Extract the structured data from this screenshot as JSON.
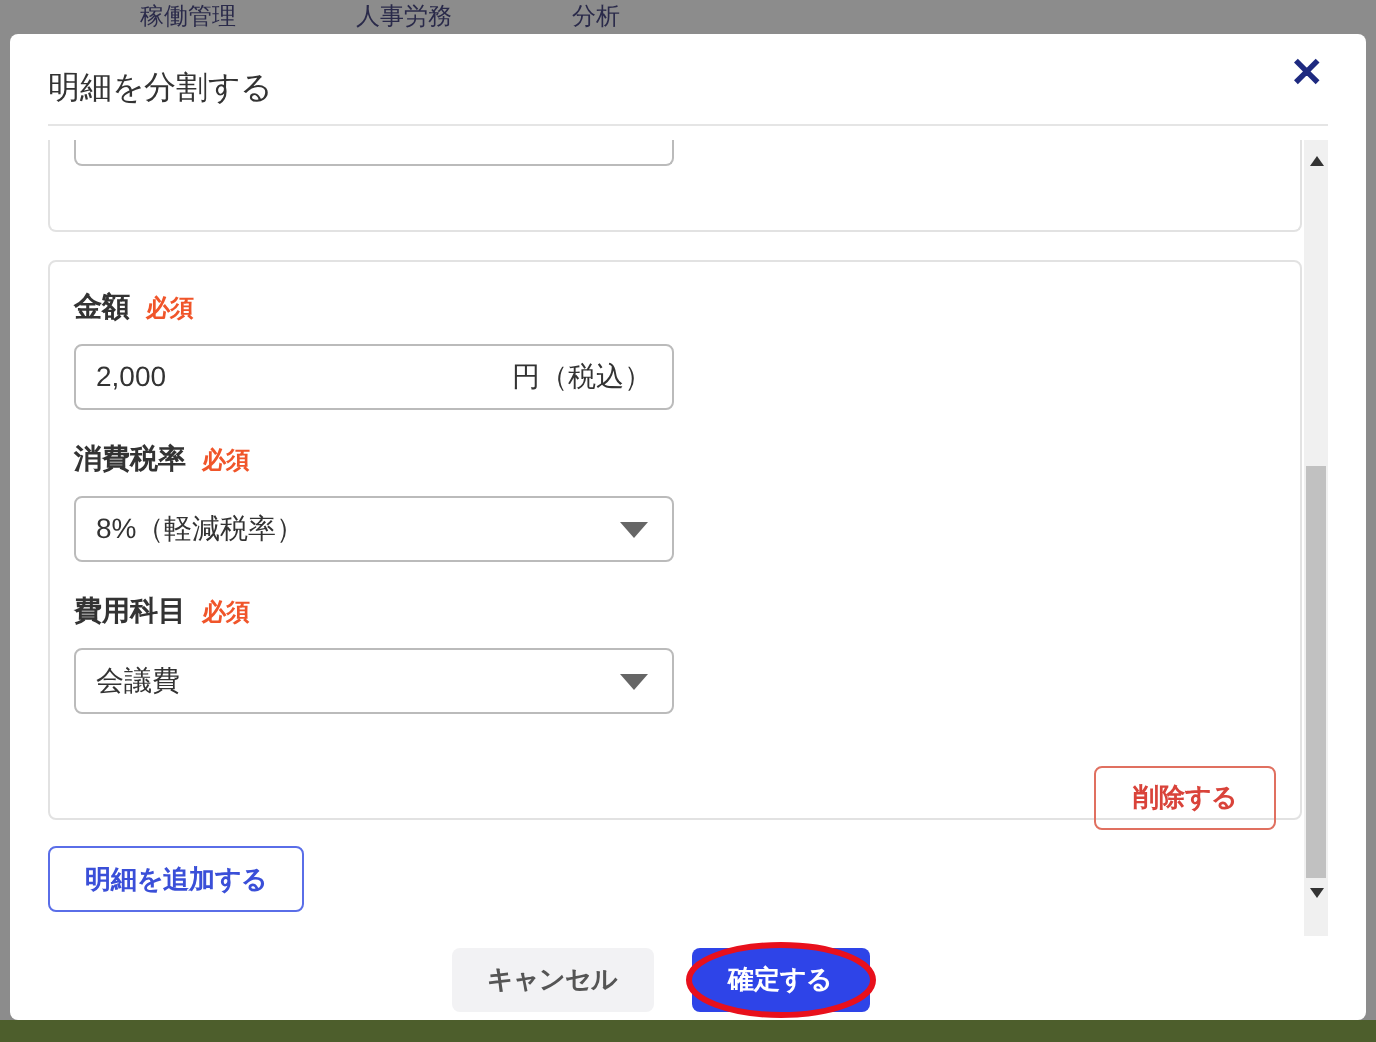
{
  "background_nav": [
    {
      "label": "稼働管理"
    },
    {
      "label": "人事労務"
    },
    {
      "label": "分析"
    }
  ],
  "dialog": {
    "title": "明細を分割する",
    "close": "✕",
    "fields": [
      {
        "kind": "input",
        "label": "金額",
        "required": "必須",
        "value": "2,000",
        "suffix": "円（税込）"
      },
      {
        "kind": "select",
        "label": "消費税率",
        "required": "必須",
        "value": "8%（軽減税率）"
      },
      {
        "kind": "select",
        "label": "費用科目",
        "required": "必須",
        "value": "会議費"
      }
    ],
    "delete_button": "削除する",
    "add_button": "明細を追加する",
    "cancel_button": "キャンセル",
    "confirm_button": {
      "label": "確定する",
      "highlighted": true
    }
  }
}
